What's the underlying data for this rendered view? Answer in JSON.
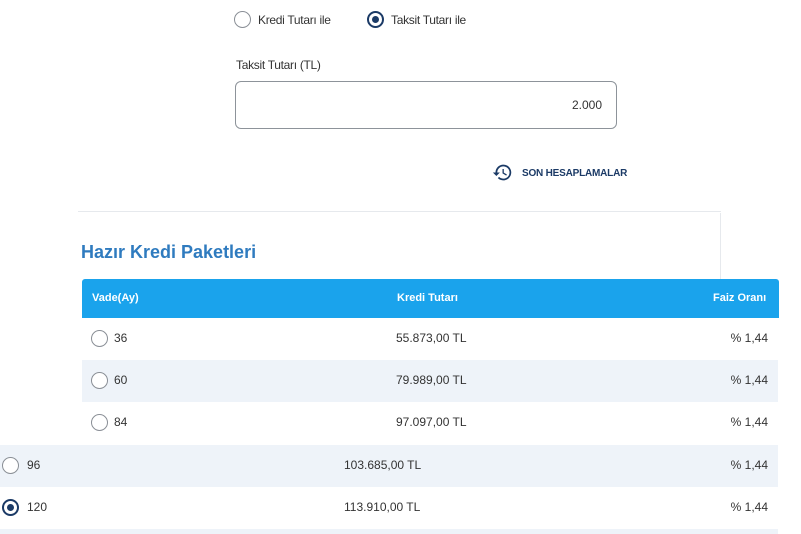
{
  "calc_mode": {
    "options": [
      {
        "label": "Kredi Tutarı ile",
        "selected": false
      },
      {
        "label": "Taksit Tutarı ile",
        "selected": true
      }
    ]
  },
  "installment_field": {
    "label": "Taksit Tutarı (TL)",
    "value": "2.000"
  },
  "recent_calcs": {
    "label": "SON HESAPLAMALAR",
    "icon": "history-icon"
  },
  "packages": {
    "title": "Hazır Kredi Paketleri",
    "columns": [
      "Vade(Ay)",
      "Kredi Tutarı",
      "Faiz Oranı"
    ],
    "rows": [
      {
        "term": "36",
        "amount": "55.873,00 TL",
        "rate": "% 1,44",
        "selected": false
      },
      {
        "term": "60",
        "amount": "79.989,00 TL",
        "rate": "% 1,44",
        "selected": false
      },
      {
        "term": "84",
        "amount": "97.097,00 TL",
        "rate": "% 1,44",
        "selected": false
      },
      {
        "term": "96",
        "amount": "103.685,00 TL",
        "rate": "% 1,44",
        "selected": false
      },
      {
        "term": "120",
        "amount": "113.910,00 TL",
        "rate": "% 1,44",
        "selected": true
      }
    ]
  },
  "colors": {
    "header_blue": "#1aa3ec",
    "title_blue": "#2f7bbf",
    "radio_selected": "#1b3a66"
  }
}
